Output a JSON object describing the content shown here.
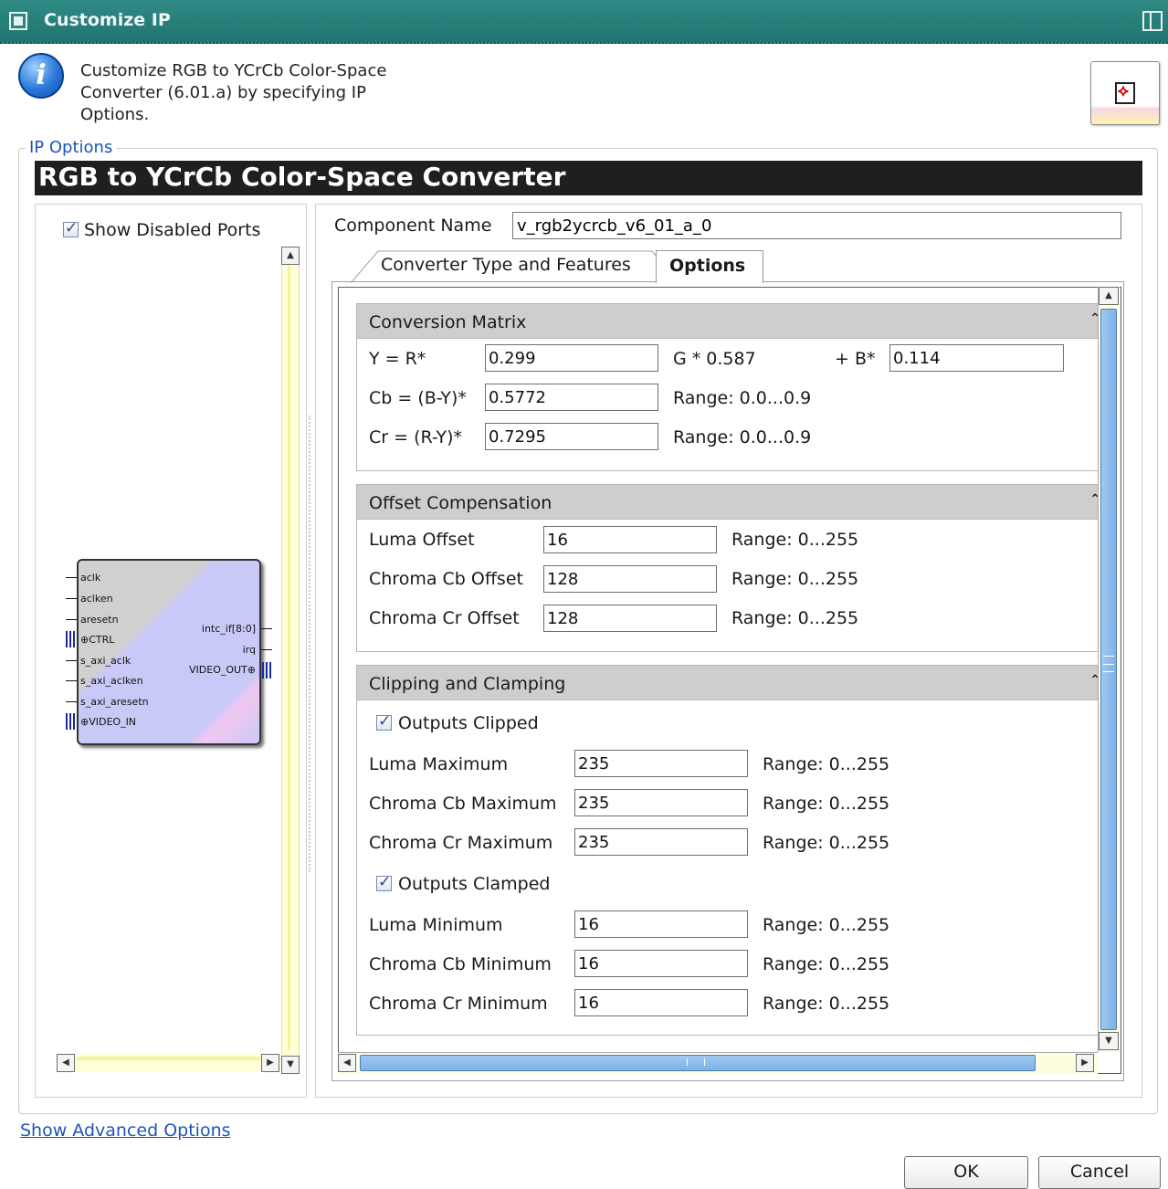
{
  "window": {
    "title": "Customize IP"
  },
  "header": {
    "description": "Customize RGB to YCrCb Color-Space Converter (6.01.a) by specifying IP Options."
  },
  "ip_options": {
    "legend": "IP Options",
    "banner": "RGB to YCrCb Color-Space Converter",
    "show_disabled_ports": {
      "label": "Show Disabled Ports",
      "checked": true
    }
  },
  "symbol": {
    "left_ports": [
      "aclk",
      "aclken",
      "aresetn",
      "CTRL",
      "s_axi_aclk",
      "s_axi_aclken",
      "s_axi_aresetn",
      "VIDEO_IN"
    ],
    "right_ports": [
      "intc_if[8:0]",
      "irq",
      "VIDEO_OUT"
    ]
  },
  "component": {
    "label": "Component Name",
    "value": "v_rgb2ycrcb_v6_01_a_0"
  },
  "tabs": [
    {
      "label": "Converter Type and Features",
      "active": false
    },
    {
      "label": "Options",
      "active": true
    }
  ],
  "conversion_matrix": {
    "title": "Conversion Matrix",
    "y_label": "Y = R*",
    "y_r": "0.299",
    "g_label": "G * 0.587",
    "b_label": "+ B*",
    "y_b": "0.114",
    "cb_label": "Cb = (B-Y)*",
    "cb_value": "0.5772",
    "cb_range": "Range: 0.0...0.9",
    "cr_label": "Cr = (R-Y)*",
    "cr_value": "0.7295",
    "cr_range": "Range: 0.0...0.9"
  },
  "offset_compensation": {
    "title": "Offset Compensation",
    "rows": [
      {
        "label": "Luma Offset",
        "value": "16",
        "range": "Range: 0...255"
      },
      {
        "label": "Chroma Cb Offset",
        "value": "128",
        "range": "Range: 0...255"
      },
      {
        "label": "Chroma Cr Offset",
        "value": "128",
        "range": "Range: 0...255"
      }
    ]
  },
  "clipping": {
    "title": "Clipping and Clamping",
    "outputs_clipped": {
      "label": "Outputs Clipped",
      "checked": true
    },
    "max_rows": [
      {
        "label": "Luma Maximum",
        "value": "235",
        "range": "Range: 0...255"
      },
      {
        "label": "Chroma Cb Maximum",
        "value": "235",
        "range": "Range: 0...255"
      },
      {
        "label": "Chroma Cr Maximum",
        "value": "235",
        "range": "Range: 0...255"
      }
    ],
    "outputs_clamped": {
      "label": "Outputs Clamped",
      "checked": true
    },
    "min_rows": [
      {
        "label": "Luma Minimum",
        "value": "16",
        "range": "Range: 0...255"
      },
      {
        "label": "Chroma Cb Minimum",
        "value": "16",
        "range": "Range: 0...255"
      },
      {
        "label": "Chroma Cr Minimum",
        "value": "16",
        "range": "Range: 0...255"
      }
    ]
  },
  "footer": {
    "advanced_link": "Show Advanced Options",
    "ok": "OK",
    "cancel": "Cancel"
  },
  "colors": {
    "titlebar": "#217570",
    "banner": "#1f1f1f",
    "link": "#1b56b7",
    "scroll_thumb": "#9ec9f2"
  },
  "icons": [
    "info-icon",
    "pdf-icon",
    "checkbox-icon",
    "collapse-icon",
    "arrow-icon"
  ]
}
